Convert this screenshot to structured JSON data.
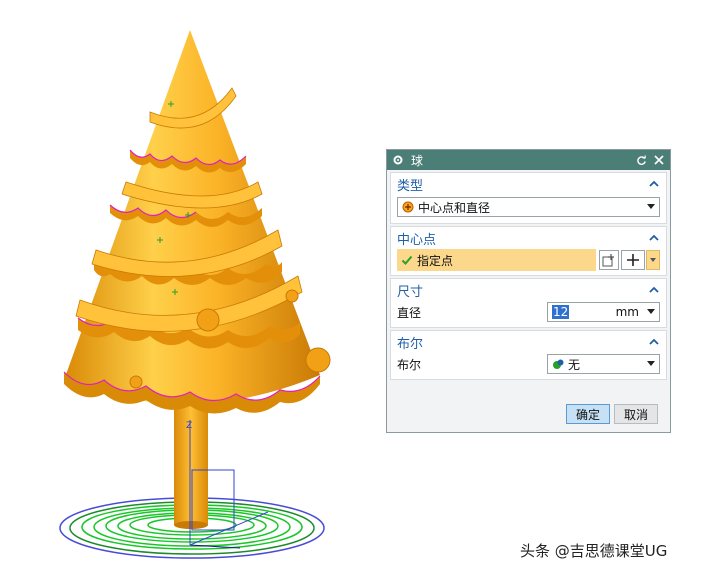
{
  "dialog": {
    "title": "球",
    "groups": {
      "type": {
        "header": "类型",
        "dropdown_value": "中心点和直径"
      },
      "center": {
        "header": "中心点",
        "select_label": "指定点"
      },
      "size": {
        "header": "尺寸",
        "diameter_label": "直径",
        "diameter_value": "12",
        "unit": "mm"
      },
      "boolean": {
        "header": "布尔",
        "boolean_label": "布尔",
        "boolean_value": "无"
      }
    },
    "buttons": {
      "ok": "确定",
      "cancel": "取消"
    }
  },
  "watermark": "头条 @吉思德课堂UG",
  "colors": {
    "model": "#f7a81b",
    "titlebar": "#4b7e76",
    "header_text": "#1f5fa8",
    "highlight": "#fbd88b"
  }
}
